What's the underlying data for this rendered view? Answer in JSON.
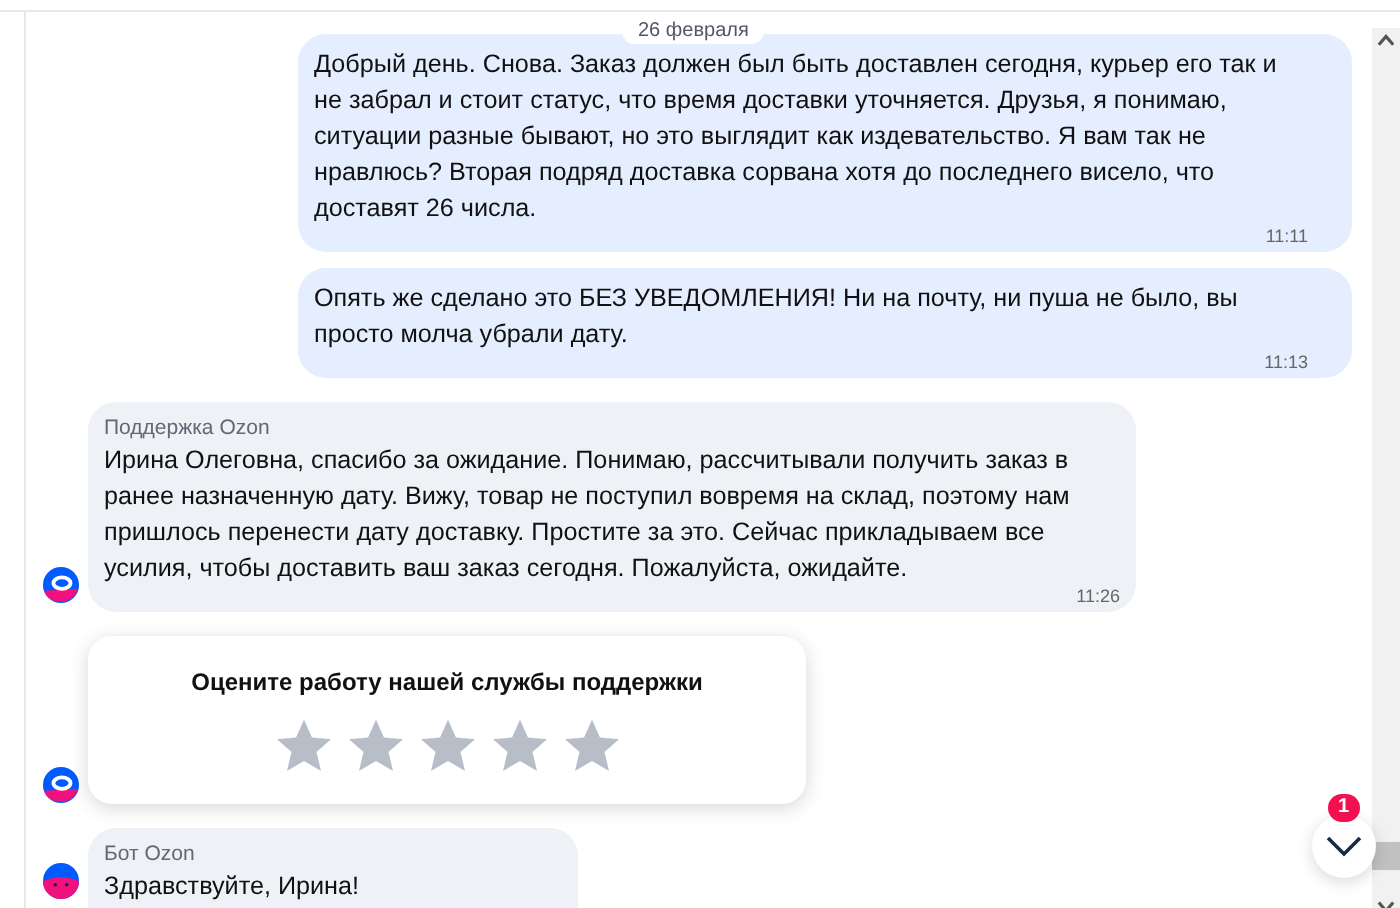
{
  "date_chip": "26 февраля",
  "messages": [
    {
      "kind": "outgoing",
      "text": "Добрый день. Снова. Заказ должен был быть доставлен сегодня, курьер его так и не забрал и стоит статус, что время доставки уточняется. Друзья, я понимаю, ситуации разные бывают, но это выглядит как издевательство. Я вам так не нравлюсь? Вторая подряд доставка сорвана хотя до последнего висело, что доставят 26 числа.",
      "time": "11:11"
    },
    {
      "kind": "outgoing",
      "text": "Опять же сделано это БЕЗ УВЕДОМЛЕНИЯ! Ни на почту, ни пуша не было, вы просто молча убрали дату.",
      "time": "11:13"
    },
    {
      "kind": "incoming",
      "sender": "Поддержка Ozon",
      "text": "Ирина Олеговна, спасибо за ожидание. Понимаю, рассчитывали получить заказ в ранее назначенную дату. Вижу, товар не поступил вовремя на склад, поэтому нам пришлось перенести дату доставку. Простите за это. Сейчас прикладываем все усилия, чтобы доставить ваш заказ сегодня. Пожалуйста, ожидайте.",
      "time": "11:26"
    },
    {
      "kind": "rating",
      "title": "Оцените работу нашей службы поддержки",
      "stars": 0
    },
    {
      "kind": "bot",
      "sender": "Бот Ozon",
      "text": "Здравствуйте, Ирина!"
    }
  ],
  "scroll_button": {
    "badge": "1"
  }
}
